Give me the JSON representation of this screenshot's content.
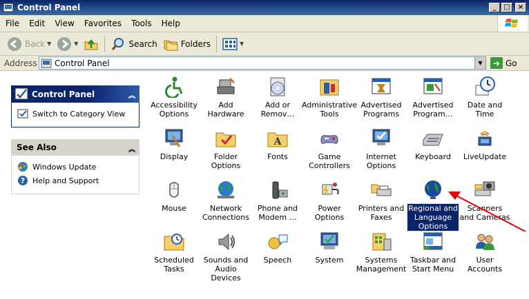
{
  "window": {
    "title": "Control Panel"
  },
  "menu": [
    "File",
    "Edit",
    "View",
    "Favorites",
    "Tools",
    "Help"
  ],
  "toolbar": {
    "back": "Back",
    "search": "Search",
    "folders": "Folders"
  },
  "address": {
    "label": "Address",
    "value": "Control Panel",
    "go": "Go"
  },
  "left_panel": {
    "control_panel": {
      "title": "Control Panel",
      "link": "Switch to Category View"
    },
    "see_also": {
      "title": "See Also",
      "links": [
        "Windows Update",
        "Help and Support"
      ]
    }
  },
  "items": [
    {
      "label": "Accessibility Options"
    },
    {
      "label": "Add Hardware"
    },
    {
      "label": "Add or Remov…"
    },
    {
      "label": "Administrative Tools"
    },
    {
      "label": "Advertised Programs"
    },
    {
      "label": "Advertised Program…"
    },
    {
      "label": "Date and Time"
    },
    {
      "label": "Display"
    },
    {
      "label": "Folder Options"
    },
    {
      "label": "Fonts"
    },
    {
      "label": "Game Controllers"
    },
    {
      "label": "Internet Options"
    },
    {
      "label": "Keyboard"
    },
    {
      "label": "LiveUpdate"
    },
    {
      "label": "Mouse"
    },
    {
      "label": "Network Connections"
    },
    {
      "label": "Phone and Modem …"
    },
    {
      "label": "Power Options"
    },
    {
      "label": "Printers and Faxes"
    },
    {
      "label": "Regional and Language Options"
    },
    {
      "label": "Scanners and Cameras"
    },
    {
      "label": "Scheduled Tasks"
    },
    {
      "label": "Sounds and Audio Devices"
    },
    {
      "label": "Speech"
    },
    {
      "label": "System"
    },
    {
      "label": "Systems Management"
    },
    {
      "label": "Taskbar and Start Menu"
    },
    {
      "label": "User Accounts"
    }
  ],
  "colors": {
    "title_bar": "#0a246a",
    "chrome": "#ece9d8",
    "selection": "#0a246a",
    "annotation_arrow": "#e00000"
  }
}
